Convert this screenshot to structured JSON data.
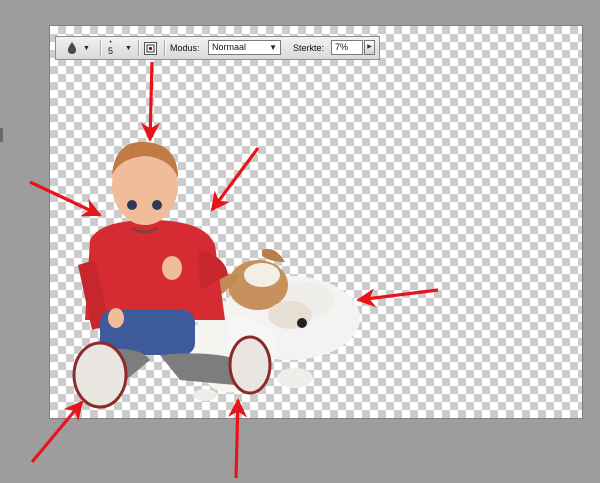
{
  "toolbar": {
    "brush_size": "5",
    "mode_label": "Modus:",
    "mode_value": "Normaal",
    "strength_label": "Sterkte:",
    "strength_value": "7%",
    "icons": [
      "blur-drop-icon",
      "brush-size-icon",
      "sample-all-layers-icon",
      "stepper-arrow-icon"
    ]
  },
  "canvas": {
    "background": "transparent-checkerboard",
    "subjects": [
      "child-in-red-sweater",
      "jack-russell-dog"
    ]
  },
  "annotations": {
    "arrow_color": "#e8141c",
    "arrows": [
      "arrow-to-toolbar-icon",
      "arrow-to-child-left",
      "arrow-to-child-right",
      "arrow-to-dog-back",
      "arrow-to-child-foot",
      "arrow-to-dog-paw"
    ]
  }
}
